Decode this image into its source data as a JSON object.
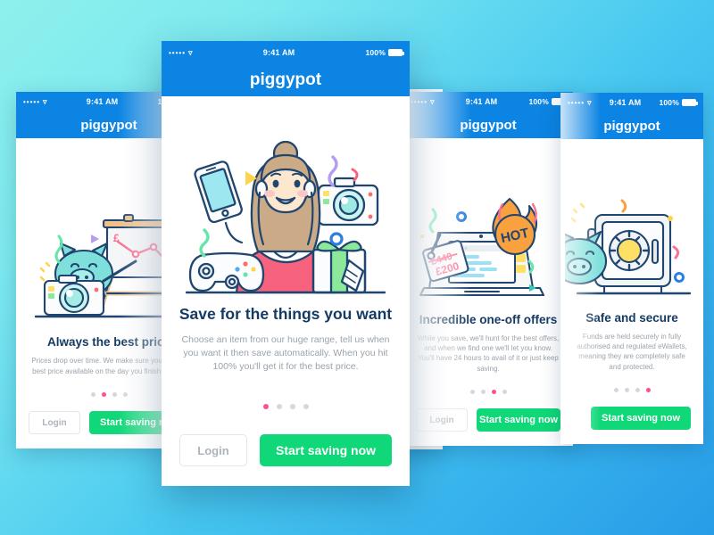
{
  "app": {
    "name": "piggypot",
    "status_bar": {
      "signal": "•••••",
      "wifi_icon": "wifi-icon",
      "time": "9:41 AM",
      "battery_text": "100%"
    },
    "buttons": {
      "login": "Login",
      "start_saving": "Start saving now"
    }
  },
  "screens": [
    {
      "id": "best-price",
      "headline": "Always the best price",
      "body": "Prices drop over time. We make sure you get the best price available on the day you finish saving.",
      "active_dot": 1,
      "illustration": "piggy-chart-camera-illustration"
    },
    {
      "id": "save-for-things",
      "headline": "Save for the things you want",
      "body": "Choose an item from our huge range, tell us when you want it then save automatically. When you hit 100% you'll get it for the best price.",
      "active_dot": 0,
      "illustration": "girl-with-products-illustration"
    },
    {
      "id": "one-off-offers",
      "headline": "Incredible one-off offers",
      "body": "While you save, we'll hunt for the best offers, and when we find one we'll let you know. You'll have 24 hours to avail of it or just keep saving.",
      "active_dot": 2,
      "illustration": "laptop-hot-deal-illustration",
      "illustration_labels": {
        "badge": "HOT",
        "old_price": "£440",
        "new_price": "£200"
      }
    },
    {
      "id": "safe-secure",
      "headline": "Safe and secure",
      "body": "Funds are held securely in fully authorised and regulated eWallets, meaning they are completely safe and protected.",
      "active_dot": 3,
      "illustration": "piggy-safe-illustration"
    }
  ],
  "dot_count": 4,
  "colors": {
    "brand_blue": "#0b84e3",
    "accent_green": "#10d878",
    "accent_pink": "#ff4d94",
    "headline_navy": "#153a63",
    "body_grey": "#9aa3ab",
    "bg_start": "#8ef0ec",
    "bg_end": "#279ce8"
  }
}
